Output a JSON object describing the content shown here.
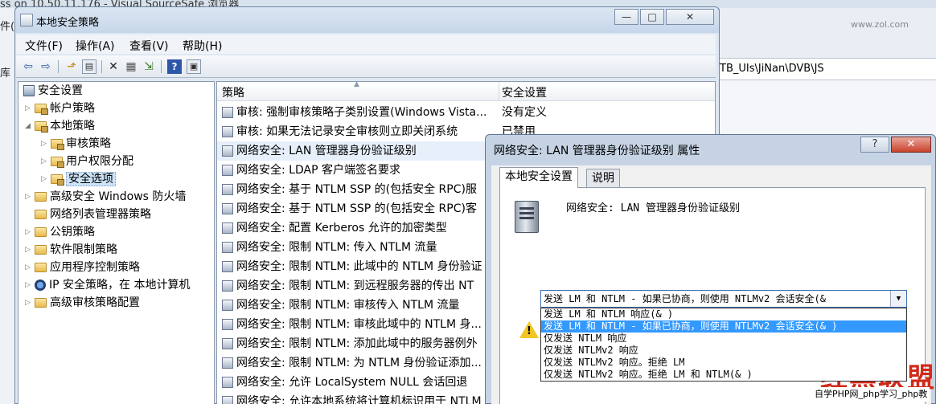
{
  "background_window": {
    "title": "ss on 10.50.11.176 - Visual SourceSafe 浏览器",
    "side_labels": [
      "件(",
      "库"
    ],
    "path": "TB_UIs\\JiNan\\DVB\\JS",
    "right_tag": "www.zol.com"
  },
  "main_window": {
    "title": "本地安全策略",
    "buttons": {
      "minimize": "—",
      "maximize": "□",
      "close": "✕"
    },
    "menu": [
      "文件(F)",
      "操作(A)",
      "查看(V)",
      "帮助(H)"
    ],
    "toolbar_glyphs": {
      "back": "⇦",
      "forward": "⇨",
      "up": "⬏",
      "show_tree": "▤",
      "delete": "✕",
      "properties": "▦",
      "export": "⇲",
      "help": "?",
      "view": "▣"
    }
  },
  "tree": {
    "root": "安全设置",
    "nodes": [
      {
        "label": "帐户策略",
        "level": 1,
        "expand": "▷",
        "icon": "folder-lock"
      },
      {
        "label": "本地策略",
        "level": 1,
        "expand": "◢",
        "icon": "folder-lock"
      },
      {
        "label": "审核策略",
        "level": 2,
        "expand": "▷",
        "icon": "folder-lock"
      },
      {
        "label": "用户权限分配",
        "level": 2,
        "expand": "▷",
        "icon": "folder-lock"
      },
      {
        "label": "安全选项",
        "level": 2,
        "expand": "▷",
        "icon": "folder-lock",
        "selected": true
      },
      {
        "label": "高级安全 Windows 防火墙",
        "level": 1,
        "expand": "▷",
        "icon": "folder"
      },
      {
        "label": "网络列表管理器策略",
        "level": 1,
        "expand": "",
        "icon": "folder"
      },
      {
        "label": "公钥策略",
        "level": 1,
        "expand": "▷",
        "icon": "folder"
      },
      {
        "label": "软件限制策略",
        "level": 1,
        "expand": "▷",
        "icon": "folder"
      },
      {
        "label": "应用程序控制策略",
        "level": 1,
        "expand": "▷",
        "icon": "folder"
      },
      {
        "label": "IP 安全策略，在 本地计算机",
        "level": 1,
        "expand": "▷",
        "icon": "ipsec"
      },
      {
        "label": "高级审核策略配置",
        "level": 1,
        "expand": "▷",
        "icon": "folder"
      }
    ]
  },
  "list": {
    "col_policy": "策略",
    "col_setting": "安全设置",
    "sort_glyph": "▲",
    "rows": [
      {
        "policy": "审核: 强制审核策略子类别设置(Windows Vista...",
        "setting": "没有定义"
      },
      {
        "policy": "审核: 如果无法记录安全审核则立即关闭系统",
        "setting": "已禁用"
      },
      {
        "policy": "网络安全: LAN 管理器身份验证级别",
        "setting": "",
        "highlight": true
      },
      {
        "policy": "网络安全: LDAP 客户端签名要求",
        "setting": ""
      },
      {
        "policy": "网络安全: 基于 NTLM SSP 的(包括安全 RPC)服",
        "setting": ""
      },
      {
        "policy": "网络安全: 基于 NTLM SSP 的(包括安全 RPC)客",
        "setting": ""
      },
      {
        "policy": "网络安全: 配置 Kerberos 允许的加密类型",
        "setting": ""
      },
      {
        "policy": "网络安全: 限制 NTLM: 传入 NTLM 流量",
        "setting": ""
      },
      {
        "policy": "网络安全: 限制 NTLM: 此域中的 NTLM 身份验证",
        "setting": ""
      },
      {
        "policy": "网络安全: 限制 NTLM: 到远程服务器的传出 NT",
        "setting": ""
      },
      {
        "policy": "网络安全: 限制 NTLM: 审核传入 NTLM 流量",
        "setting": ""
      },
      {
        "policy": "网络安全: 限制 NTLM: 审核此域中的 NTLM 身...",
        "setting": ""
      },
      {
        "policy": "网络安全: 限制 NTLM: 添加此域中的服务器例外",
        "setting": ""
      },
      {
        "policy": "网络安全: 限制 NTLM: 为 NTLM 身份验证添加...",
        "setting": ""
      },
      {
        "policy": "网络安全: 允许 LocalSystem NULL 会话回退",
        "setting": ""
      },
      {
        "policy": "网络安全: 允许本地系统将计算机标识用于 NTLM",
        "setting": ""
      }
    ]
  },
  "dialog": {
    "title": "网络安全: LAN 管理器身份验证级别 属性",
    "help_glyph": "?",
    "close_glyph": "✕",
    "tabs": [
      "本地安全设置",
      "说明"
    ],
    "policy_name": "网络安全: LAN 管理器身份验证级别",
    "selected_value": "发送 LM 和 NTLM - 如果已协商，则使用 NTLMv2 会话安全(&",
    "combo_arrow": "▼",
    "options": [
      "发送 LM 和 NTLM 响应(& )",
      "发送 LM 和 NTLM - 如果已协商，则使用 NTLMv2 会话安全(& )",
      "仅发送 NTLM 响应",
      "仅发送 NTLMv2 响应",
      "仅发送 NTLMv2 响应。拒绝 LM",
      "仅发送 NTLMv2 响应。拒绝 LM 和 NTLM(& )"
    ],
    "selected_index": 1,
    "warning_glyph": "!"
  },
  "watermark": {
    "logo": "红黑联盟",
    "caption": "自学PHP网_php学习_php教"
  }
}
